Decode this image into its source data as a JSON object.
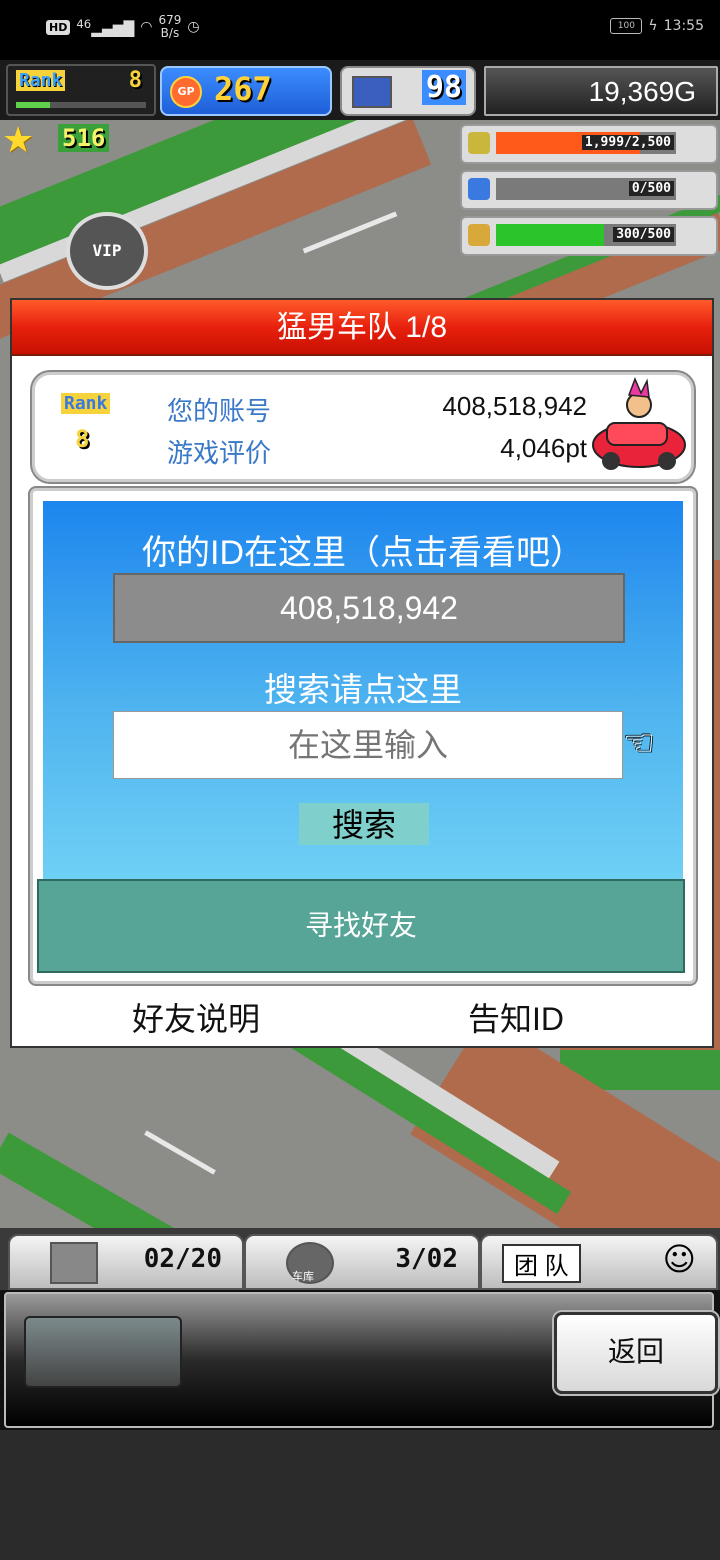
{
  "status_bar": {
    "hd": "HD",
    "signal": "46",
    "net_speed_value": "679",
    "net_speed_unit": "B/s",
    "battery": "100",
    "time": "13:55"
  },
  "hud": {
    "rank_label": "Rank",
    "rank_value": "8",
    "gp_icon": "GP",
    "gp_value": "267",
    "pc_value": "98",
    "money": "19,369G",
    "star_value": "516"
  },
  "resources": [
    {
      "icon": "coin-stack-icon",
      "text": "1,999/2,500",
      "fill": 0.8,
      "color": "#ff5a1a"
    },
    {
      "icon": "fuel-bottle-icon",
      "text": "0/500",
      "fill": 0.0,
      "color": "#3a7ae0"
    },
    {
      "icon": "wheat-icon",
      "text": "300/500",
      "fill": 0.6,
      "color": "#2bc42b"
    }
  ],
  "vip_text": "VIP",
  "dialog": {
    "title": "猛男车队 1/8",
    "rank_label": "Rank",
    "rank_value": "8",
    "account_label": "您的账号",
    "account_value": "408,518,942",
    "rating_label": "游戏评价",
    "rating_value": "4,046pt",
    "id_title": "你的ID在这里（点击看看吧）",
    "id_value": "408,518,942",
    "search_hint": "搜索请点这里",
    "search_placeholder": "在这里输入",
    "search_button": "搜索",
    "find_friend": "寻找好友",
    "friend_help": "好友说明",
    "tell_id": "告知ID"
  },
  "tabs": {
    "tab1_value": "02/20",
    "tab2_label": "车库",
    "tab2_value": "3/02",
    "tab3_label": "团 队"
  },
  "bottom": {
    "back_label": "返回"
  }
}
